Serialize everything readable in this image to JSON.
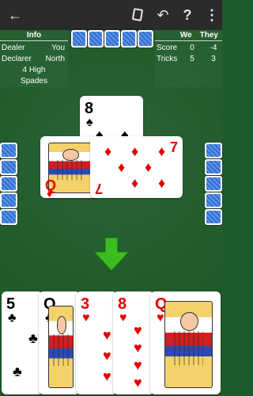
{
  "topbar": {
    "back_icon": "back-arrow-icon",
    "icons": [
      "card-icon",
      "undo-icon",
      "help-icon",
      "more-vert-icon"
    ]
  },
  "info": {
    "title": "Info",
    "rows": [
      {
        "label": "Dealer",
        "value": "You"
      },
      {
        "label": "Declarer",
        "value": "North"
      }
    ],
    "contract_line1": "4 High",
    "contract_line2": "Spades"
  },
  "score": {
    "col_we": "We",
    "col_they": "They",
    "rows": [
      {
        "label": "Score",
        "we": "0",
        "they": "-4"
      },
      {
        "label": "Tricks",
        "we": "5",
        "they": "3"
      }
    ]
  },
  "center": {
    "north_card": {
      "rank": "8",
      "suit": "♠"
    },
    "west_card": {
      "rank": "Q",
      "suit": "♦"
    },
    "east_card": {
      "rank": "7",
      "suit": "♦"
    }
  },
  "hand": {
    "cards": [
      {
        "rank": "5",
        "suit": "♣"
      },
      {
        "rank": "Q",
        "suit": "♣"
      },
      {
        "rank": "3",
        "suit": "♥"
      },
      {
        "rank": "8",
        "suit": "♥"
      },
      {
        "rank": "Q",
        "suit": "♥"
      }
    ]
  },
  "arrow": {
    "color": "#3bbd1f"
  }
}
